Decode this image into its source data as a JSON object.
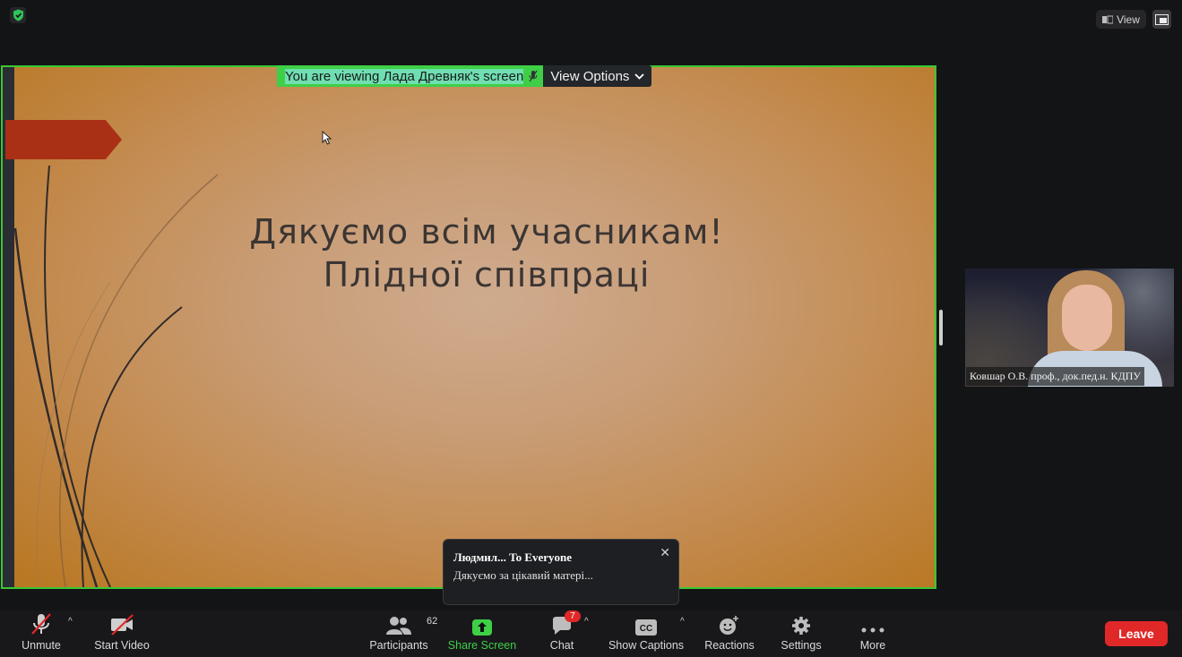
{
  "top_bar": {
    "view_label": "View"
  },
  "share": {
    "viewing_prefix": "You are viewing",
    "viewing_name": "Лада Древняк's screen",
    "view_options_label": "View Options"
  },
  "slide": {
    "title_line1": "Дякуємо всім учасникам!",
    "title_line2": "Плідної співпраці"
  },
  "video": {
    "participant_name": "Ковшар О.В. проф., док.пед.н. КДПУ"
  },
  "chat_notification": {
    "sender": "Людмил... To Everyone",
    "message": "Дякуємо за цікавий матері..."
  },
  "toolbar": {
    "unmute_label": "Unmute",
    "start_video_label": "Start Video",
    "participants_label": "Participants",
    "participants_count": "62",
    "share_screen_label": "Share Screen",
    "chat_label": "Chat",
    "chat_badge": "7",
    "captions_label": "Show Captions",
    "reactions_label": "Reactions",
    "settings_label": "Settings",
    "more_label": "More",
    "leave_label": "Leave"
  },
  "colors": {
    "share_border": "#39c832",
    "share_screen_green": "#3ecf47",
    "leave_red": "#e02828",
    "toolbar_bg": "#18181b"
  }
}
